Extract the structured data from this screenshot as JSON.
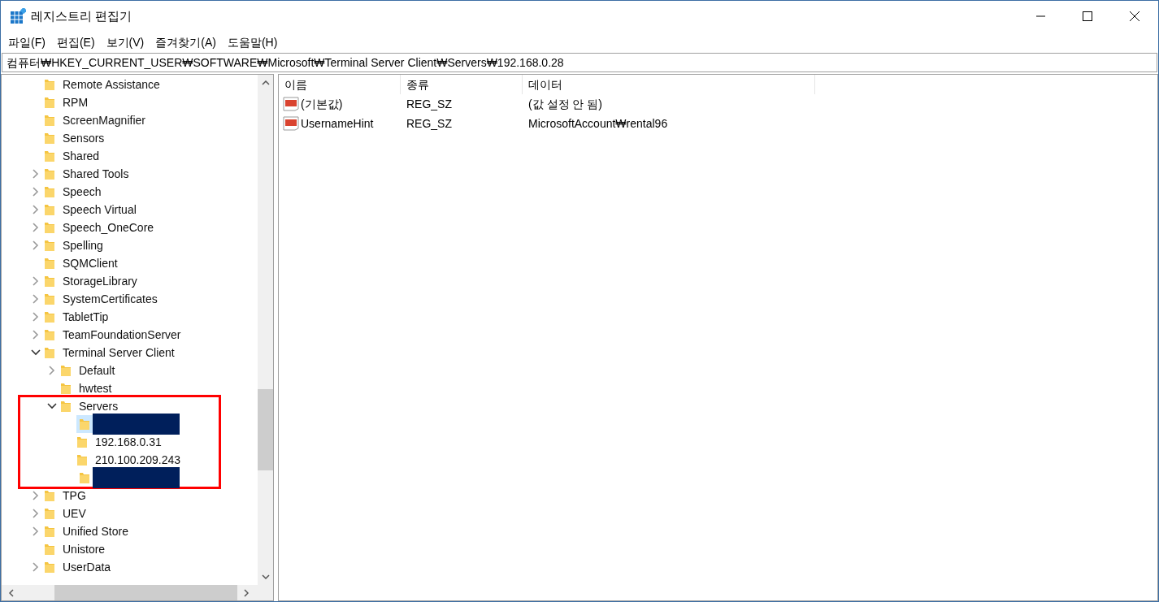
{
  "window": {
    "title": "레지스트리 편집기"
  },
  "menu": [
    "파일(F)",
    "편집(E)",
    "보기(V)",
    "즐겨찾기(A)",
    "도움말(H)"
  ],
  "address": "컴퓨터₩HKEY_CURRENT_USER₩SOFTWARE₩Microsoft₩Terminal Server Client₩Servers₩192.168.0.28",
  "tree": [
    {
      "label": "Remote Assistance",
      "kind": "leaf"
    },
    {
      "label": "RPM",
      "kind": "leaf"
    },
    {
      "label": "ScreenMagnifier",
      "kind": "leaf"
    },
    {
      "label": "Sensors",
      "kind": "leaf"
    },
    {
      "label": "Shared",
      "kind": "leaf"
    },
    {
      "label": "Shared Tools",
      "kind": "branch",
      "expanded": false
    },
    {
      "label": "Speech",
      "kind": "branch",
      "expanded": false
    },
    {
      "label": "Speech Virtual",
      "kind": "branch",
      "expanded": false
    },
    {
      "label": "Speech_OneCore",
      "kind": "branch",
      "expanded": false
    },
    {
      "label": "Spelling",
      "kind": "branch",
      "expanded": false
    },
    {
      "label": "SQMClient",
      "kind": "leaf"
    },
    {
      "label": "StorageLibrary",
      "kind": "branch",
      "expanded": false
    },
    {
      "label": "SystemCertificates",
      "kind": "branch",
      "expanded": false
    },
    {
      "label": "TabletTip",
      "kind": "branch",
      "expanded": false
    },
    {
      "label": "TeamFoundationServer",
      "kind": "branch",
      "expanded": false
    },
    {
      "label": "Terminal Server Client",
      "kind": "branch",
      "expanded": true,
      "children": [
        {
          "label": "Default",
          "kind": "branch",
          "expanded": false
        },
        {
          "label": "hwtest",
          "kind": "leaf"
        },
        {
          "label": "Servers",
          "kind": "branch",
          "expanded": true,
          "annotated": true,
          "children": [
            {
              "kind": "redacted",
              "selected": true
            },
            {
              "label": "192.168.0.31",
              "kind": "leaf",
              "selected": false
            },
            {
              "label": "210.100.209.243",
              "kind": "leaf",
              "selected": false
            },
            {
              "kind": "redacted",
              "selected": false
            }
          ]
        }
      ]
    },
    {
      "label": "TPG",
      "kind": "branch",
      "expanded": false
    },
    {
      "label": "UEV",
      "kind": "branch",
      "expanded": false
    },
    {
      "label": "Unified Store",
      "kind": "branch",
      "expanded": false
    },
    {
      "label": "Unistore",
      "kind": "leaf"
    },
    {
      "label": "UserData",
      "kind": "branch",
      "expanded": false
    }
  ],
  "values_table": {
    "columns": [
      "이름",
      "종류",
      "데이터"
    ],
    "rows": [
      {
        "name": "(기본값)",
        "type": "REG_SZ",
        "data": "(값 설정 안 됨)"
      },
      {
        "name": "UsernameHint",
        "type": "REG_SZ",
        "data": "MicrosoftAccount₩rental96"
      }
    ]
  }
}
